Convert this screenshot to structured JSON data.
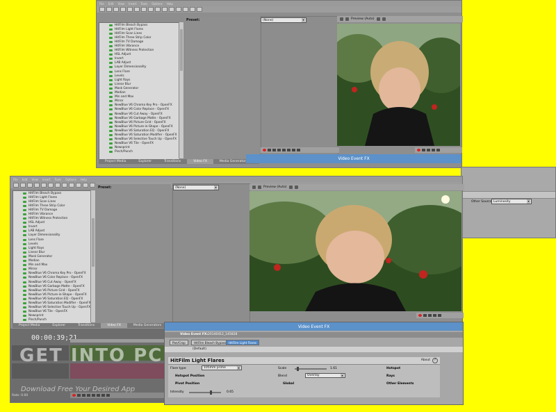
{
  "fx_items": [
    "HitFilm Bleach Bypass",
    "HitFilm Light Flares",
    "HitFilm Scan Lines",
    "HitFilm Three Strip Color",
    "HitFilm TV Damage",
    "HitFilm Vibrance",
    "HitFilm Witness Protection",
    "HSL Adjust",
    "Invert",
    "LAB Adjust",
    "Layer Dimensionality",
    "Lens Flare",
    "Levels",
    "Light Rays",
    "Linear Blur",
    "Mask Generator",
    "Median",
    "Min and Max",
    "Mirror",
    "NewBlue V6 Chroma Key Pro - OpenFX",
    "NewBlue V6 Color Replace - OpenFX",
    "NewBlue V6 Cut Away - OpenFX",
    "NewBlue V6 Garbage Matte - OpenFX",
    "NewBlue V6 Picture Grid - OpenFX",
    "NewBlue V6 Picture-in-Shape - OpenFX",
    "NewBlue V6 Saturation EQ - OpenFX",
    "NewBlue V6 Saturation Modifier - OpenFX",
    "NewBlue V6 Selective Touch Up - OpenFX",
    "NewBlue V6 Tile - OpenFX",
    "Newsprint",
    "Pinch/Punch"
  ],
  "preset_label": "Preset:",
  "preset_value": "(None)",
  "preview_label": "Preview (Auto)",
  "tabs": [
    "Project Media",
    "Explorer",
    "Transitions",
    "Video FX",
    "Media Generators"
  ],
  "video_event_fx_title": "Video Event FX",
  "timecode": "00:00:39;21",
  "video_event_fx_label": "Video Event FX:",
  "event_name": "20140412_145828",
  "chain": [
    "Pan/Crop",
    "HitFilm Bleach Bypass",
    "HitFilm Light Flares"
  ],
  "default_preset": "(Default)",
  "plugin_title": "HitFilm Light Flares",
  "about_label": "About",
  "help_icon_text": "?",
  "params": {
    "flare_label": "Flare type",
    "flare_value": "105mm prime",
    "scale_label": "Scale",
    "scale_value": "1.61",
    "blend_label": "Blend",
    "blend_value": "Overlay",
    "intensity_label": "Intensity",
    "intensity_value": "0.65"
  },
  "sections": [
    "Hotspot",
    "Rays",
    "Hotspot Position",
    "Pivot Position",
    "Global",
    "Other Elements"
  ],
  "other_source_label": "Other Source:",
  "other_source_value": "Luminosity",
  "watermark_logo": "GET INTO PC",
  "watermark_tagline": "Download Free Your Desired App",
  "ratio_label": "Rate: 0.00",
  "colors": {
    "background": "#ffff00",
    "accent": "#5c91c9"
  }
}
